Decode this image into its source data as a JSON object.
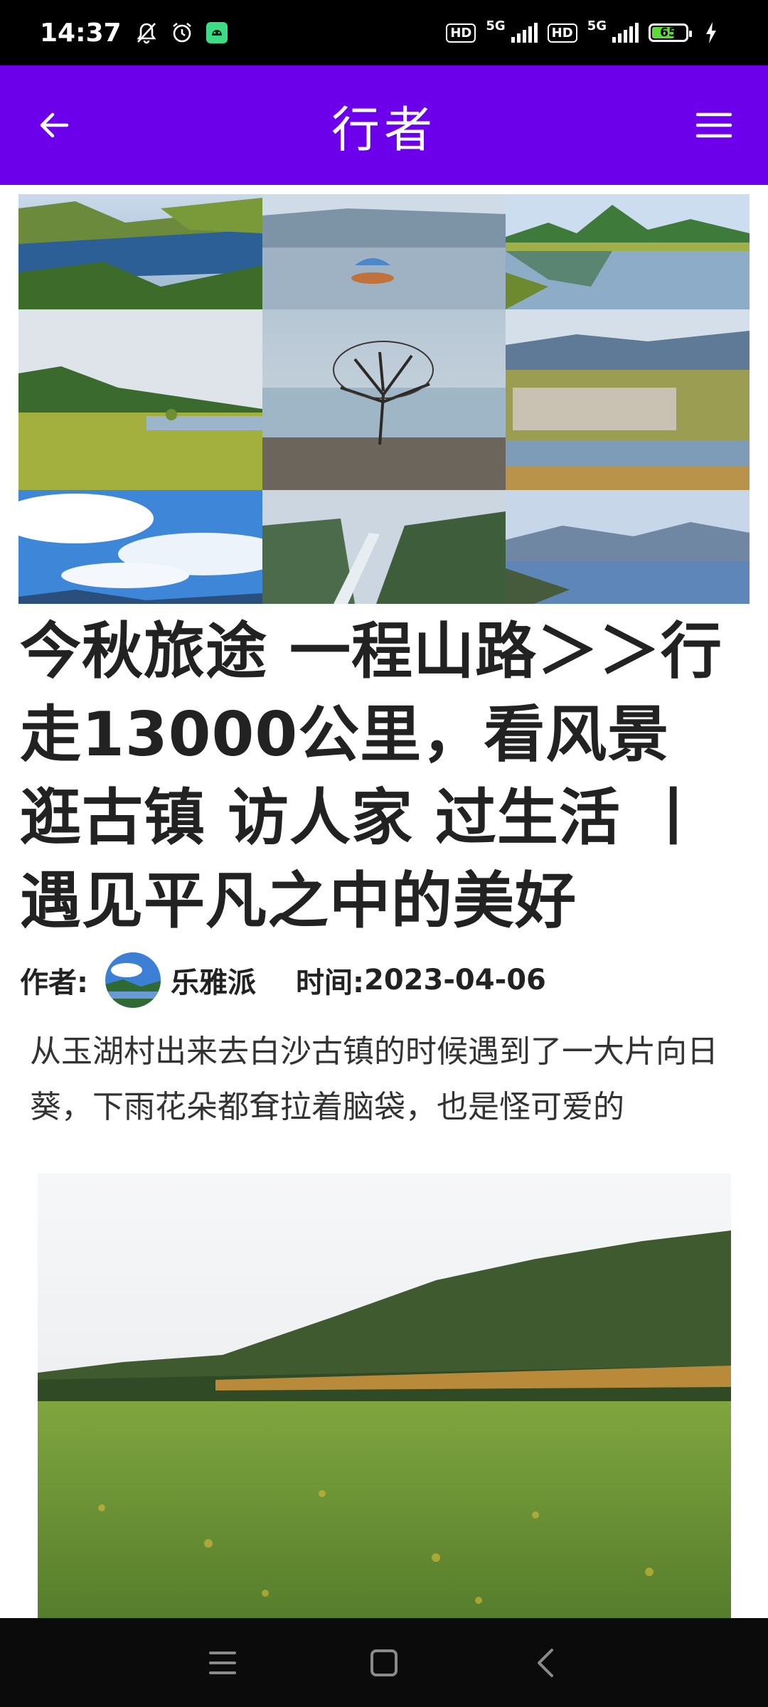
{
  "status_bar": {
    "time": "14:37",
    "icons": [
      "mute-bell-icon",
      "alarm-icon",
      "android-icon"
    ],
    "network": [
      "HD",
      "5G",
      "HD",
      "5G"
    ],
    "battery_level": "65"
  },
  "app_bar": {
    "title": "行者",
    "back_icon": "arrow-left-icon",
    "menu_icon": "hamburger-menu-icon",
    "color": "#6c00ea"
  },
  "gallery": {
    "images": [
      "lake-valley",
      "boat-on-lake",
      "green-hills-reflection",
      "grassland",
      "lone-tree-lakeshore",
      "village-by-lake",
      "blue-sky-clouds",
      "river-canyon",
      "lake-mountains"
    ]
  },
  "article": {
    "title": "今秋旅途 一程山路＞＞行走13000公里，看风景 逛古镇 访人家 过生活 丨 遇见平凡之中的美好",
    "author_label": "作者:",
    "author_name": "乐雅派",
    "time_label": "时间:",
    "date": "2023-04-06",
    "paragraph": "从玉湖村出来去白沙古镇的时候遇到了一大片向日葵，下雨花朵都耷拉着脑袋，也是怪可爱的",
    "hero_image": "sunflower-field-hills"
  },
  "nav_bar": {
    "icons": [
      "recent-apps-icon",
      "home-icon",
      "back-icon"
    ]
  }
}
